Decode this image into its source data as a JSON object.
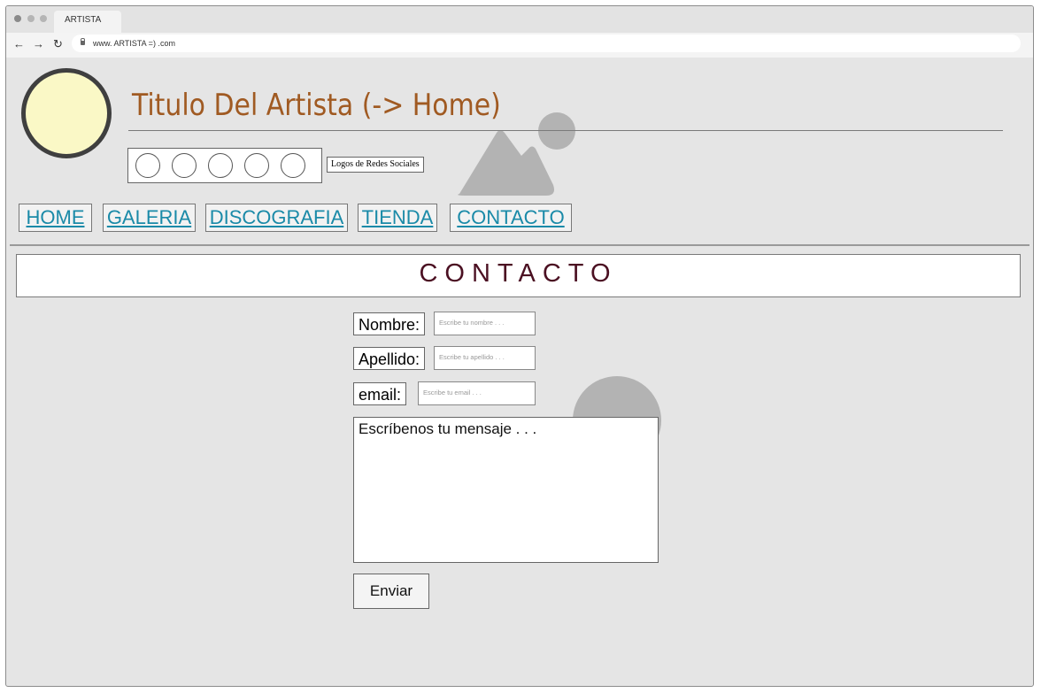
{
  "browser": {
    "tab_title": "ARTISTA",
    "url": "www. ARTISTA =) .com",
    "back_icon": "←",
    "forward_icon": "→",
    "reload_icon": "↻"
  },
  "header": {
    "title": "Titulo Del Artista (-> Home)",
    "social_label": "Logos de Redes Sociales"
  },
  "nav": {
    "items": [
      {
        "label": "HOME"
      },
      {
        "label": "GALERIA"
      },
      {
        "label": "DISCOGRAFIA"
      },
      {
        "label": "TIENDA"
      },
      {
        "label": "CONTACTO"
      }
    ]
  },
  "section": {
    "title": "CONTACTO"
  },
  "form": {
    "name_label": "Nombre:",
    "name_placeholder": "Escribe tu nombre . . .",
    "lastname_label": "Apellido:",
    "lastname_placeholder": "Escribe tu apellido . . .",
    "email_label": "email:",
    "email_placeholder": "Escribe tu email . . .",
    "message_placeholder": "Escríbenos tu mensaje . . .",
    "submit_label": "Enviar"
  },
  "colors": {
    "title": "#a05a22",
    "nav_link": "#1a8aa8",
    "section_title": "#4b1022",
    "avatar_fill": "#faf8c6",
    "page_bg": "#e5e5e5"
  }
}
